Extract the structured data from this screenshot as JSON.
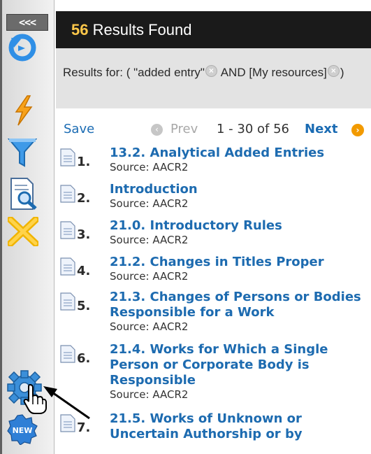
{
  "toolbar": {
    "collapse_label": "<<<",
    "icons": [
      "refresh-icon",
      "lightning-icon",
      "filter-icon",
      "search-document-icon",
      "clear-icon",
      "settings-icon",
      "new-badge-icon"
    ],
    "new_badge_label": "NEW"
  },
  "header": {
    "count": "56",
    "label": " Results Found"
  },
  "query": {
    "prefix": "Results for: ( \"added entry\"",
    "operator": " AND [My resources]",
    "suffix": ")"
  },
  "pager": {
    "save_label": "Save",
    "prev_label": "Prev",
    "range_label": "1 - 30 of 56",
    "next_label": "Next"
  },
  "results": [
    {
      "num": "1.",
      "title": "13.2. Analytical Added Entries",
      "source": "Source: AACR2"
    },
    {
      "num": "2.",
      "title": "Introduction",
      "source": "Source: AACR2"
    },
    {
      "num": "3.",
      "title": "21.0. Introductory Rules",
      "source": "Source: AACR2"
    },
    {
      "num": "4.",
      "title": "21.2. Changes in Titles Proper",
      "source": "Source: AACR2"
    },
    {
      "num": "5.",
      "title": "21.3. Changes of Persons or Bodies Responsible for a Work",
      "source": "Source: AACR2"
    },
    {
      "num": "6.",
      "title": "21.4. Works for Which a Single Person or Corporate Body is Responsible",
      "source": "Source: AACR2"
    },
    {
      "num": "7.",
      "title": "21.5. Works of Unknown or Uncertain Authorship or by",
      "source": ""
    }
  ],
  "colors": {
    "header_bg": "#1a1a1a",
    "count_accent": "#ffc84a",
    "link_blue": "#1d6bb0",
    "next_orange": "#f29a00"
  }
}
